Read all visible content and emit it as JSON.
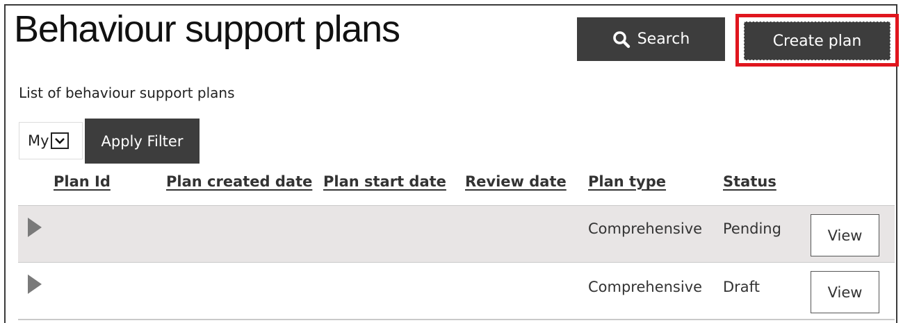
{
  "header": {
    "title": "Behaviour support plans",
    "search_label": "Search",
    "search_icon": "magnifier",
    "create_label": "Create plan",
    "highlight_color": "#e0161e"
  },
  "list": {
    "caption": "List of behaviour support plans"
  },
  "filter": {
    "selected": "My",
    "apply_label": "Apply Filter"
  },
  "table": {
    "columns": [
      "Plan Id",
      "Plan created date",
      "Plan start date",
      "Review date",
      "Plan type",
      "Status"
    ],
    "rows": [
      {
        "plan_id": "",
        "created": "",
        "start": "",
        "review": "",
        "type": "Comprehensive",
        "status": "Pending",
        "action": "View"
      },
      {
        "plan_id": "",
        "created": "",
        "start": "",
        "review": "",
        "type": "Comprehensive",
        "status": "Draft",
        "action": "View"
      }
    ]
  },
  "colors": {
    "button_dark": "#3d3d3d",
    "row_highlight": "#e8e5e5"
  }
}
